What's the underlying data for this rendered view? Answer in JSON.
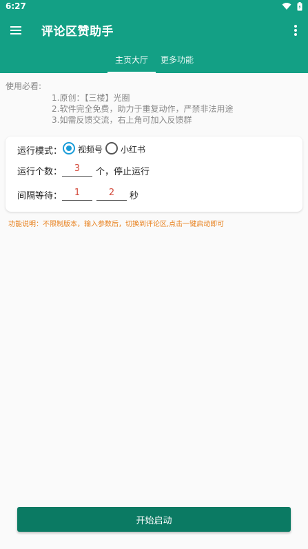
{
  "status_bar": {
    "time": "6:27",
    "icons": [
      "wifi-icon",
      "battery-icon"
    ]
  },
  "app_bar": {
    "title": "评论区赞助手",
    "menu_icon": "hamburger-menu-icon",
    "more_icon": "more-vertical-icon"
  },
  "tabs": [
    {
      "label": "主页大厅",
      "active": true
    },
    {
      "label": "更多功能",
      "active": false
    }
  ],
  "usage": {
    "title": "使用必看:",
    "lines": [
      "1.原创：【三楼】光圈",
      "2.软件完全免费，助力于重复动作，严禁非法用途",
      "3.如需反馈交流，右上角可加入反馈群"
    ]
  },
  "settings": {
    "mode_label": "运行模式：",
    "mode_options": [
      {
        "label": "视频号",
        "checked": true
      },
      {
        "label": "小红书",
        "checked": false
      }
    ],
    "count_label": "运行个数：",
    "count_value": "3",
    "count_suffix": "个，停止运行",
    "interval_label": "间隔等待：",
    "interval_min": "1",
    "interval_max": "2",
    "interval_suffix": "秒"
  },
  "function_note": "功能说明：不限制版本，输入参数后，切换到评论区,点击一键启动即可",
  "start_button": "开始启动",
  "colors": {
    "primary": "#13a085",
    "button": "#0b7a63",
    "radio_accent": "#1a9cd8",
    "input_value": "#d34a3c",
    "note": "#e8811e"
  }
}
